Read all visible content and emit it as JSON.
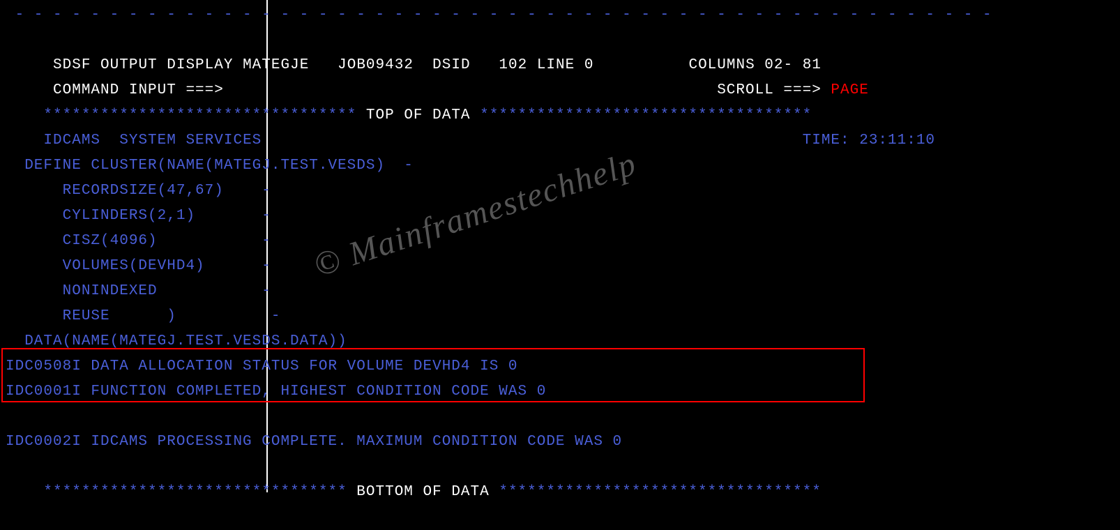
{
  "dashed_border": " - - - - - - - - - - - - - - - - - - - - - - - - - - - - - - - - - - - - - - - - - - - - - - - - - - - -",
  "header": {
    "prefix": " SDSF OUTPUT DISPLAY",
    "jobname": "MATEGJE",
    "jobid": "JOB09432",
    "dsid_label": "DSID",
    "dsid_value": "102",
    "line_label": "LINE 0",
    "columns": "COLUMNS 02- 81"
  },
  "command": {
    "label": " COMMAND INPUT ===>",
    "scroll_label": "SCROLL ===>",
    "scroll_value": "PAGE"
  },
  "top_divider": {
    "stars_left": "********************************* ",
    "text": "TOP OF DATA",
    "stars_right": " ***********************************"
  },
  "body": {
    "line1_left": "IDCAMS  SYSTEM SERVICES",
    "line1_right": "TIME: 23:11:10",
    "empty": " ",
    "define1": "  DEFINE CLUSTER(NAME(MATEGJ.TEST.VESDS)  -",
    "define2": "      RECORDSIZE(47,67)    -",
    "define3": "      CYLINDERS(2,1)       -",
    "define4": "      CISZ(4096)           -",
    "define5": "      VOLUMES(DEVHD4)      -",
    "define6": "      NONINDEXED           -",
    "define7": "      REUSE      )          -",
    "define8": "  DATA(NAME(MATEGJ.TEST.VESDS.DATA))",
    "msg1": "IDC0508I DATA ALLOCATION STATUS FOR VOLUME DEVHD4 IS 0",
    "msg2": "IDC0001I FUNCTION COMPLETED, HIGHEST CONDITION CODE WAS 0",
    "msg3": "IDC0002I IDCAMS PROCESSING COMPLETE. MAXIMUM CONDITION CODE WAS 0"
  },
  "bottom_divider": {
    "stars_left": "******************************** ",
    "text": "BOTTOM OF DATA",
    "stars_right": " **********************************"
  },
  "watermark_text": "© Mainframestechhelp"
}
